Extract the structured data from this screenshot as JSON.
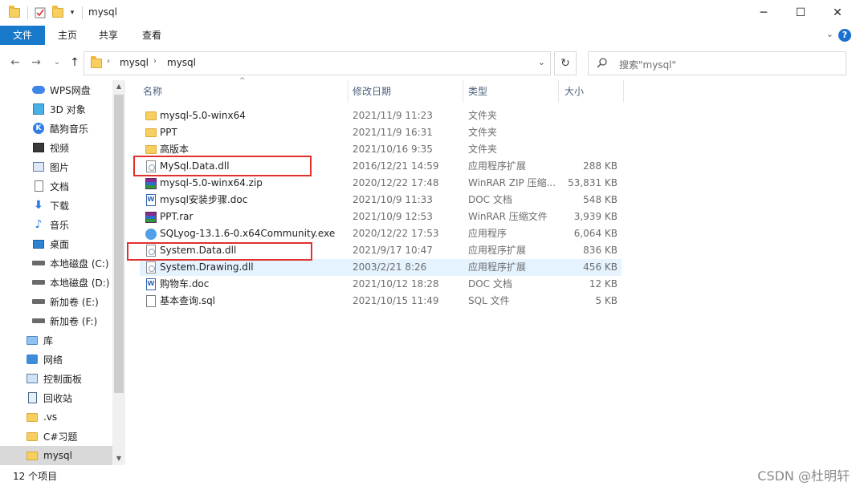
{
  "title_bar": {
    "title": "mysql",
    "minimize": "─",
    "maximize": "☐",
    "close": "✕"
  },
  "ribbon": {
    "tabs": [
      "文件",
      "主页",
      "共享",
      "查看"
    ],
    "help": "?"
  },
  "address": {
    "back": "←",
    "forward": "→",
    "recent": "⌄",
    "up": "↑",
    "crumbs": [
      "mysql",
      "mysql"
    ],
    "crumb_sep": "›",
    "dropdown": "⌄",
    "refresh": "↻",
    "search_placeholder": "搜索\"mysql\""
  },
  "nav": {
    "items": [
      {
        "label": "WPS网盘",
        "icon": "cloud-icon"
      },
      {
        "label": "3D 对象",
        "icon": "cube-icon"
      },
      {
        "label": "酷狗音乐",
        "icon": "kugou-icon"
      },
      {
        "label": "视频",
        "icon": "video-icon"
      },
      {
        "label": "图片",
        "icon": "pictures-icon"
      },
      {
        "label": "文档",
        "icon": "documents-icon"
      },
      {
        "label": "下载",
        "icon": "download-icon"
      },
      {
        "label": "音乐",
        "icon": "music-icon"
      },
      {
        "label": "桌面",
        "icon": "desktop-icon"
      },
      {
        "label": "本地磁盘 (C:)",
        "icon": "drive-icon"
      },
      {
        "label": "本地磁盘 (D:)",
        "icon": "drive-icon"
      },
      {
        "label": "新加卷 (E:)",
        "icon": "drive-icon"
      },
      {
        "label": "新加卷 (F:)",
        "icon": "drive-icon"
      },
      {
        "label": "库",
        "icon": "library-icon"
      },
      {
        "label": "网络",
        "icon": "network-icon"
      },
      {
        "label": "控制面板",
        "icon": "control-panel-icon"
      },
      {
        "label": "回收站",
        "icon": "recycle-bin-icon"
      },
      {
        "label": ".vs",
        "icon": "folder-icon"
      },
      {
        "label": "C#习题",
        "icon": "folder-icon"
      },
      {
        "label": "mysql",
        "icon": "folder-icon",
        "selected": true
      }
    ]
  },
  "columns": {
    "name": "名称",
    "date": "修改日期",
    "type": "类型",
    "size": "大小",
    "sort_indicator": "^"
  },
  "files": [
    {
      "name": "mysql-5.0-winx64",
      "date": "2021/11/9 11:23",
      "type": "文件夹",
      "size": "",
      "icon": "folder"
    },
    {
      "name": "PPT",
      "date": "2021/11/9 16:31",
      "type": "文件夹",
      "size": "",
      "icon": "folder"
    },
    {
      "name": "高版本",
      "date": "2021/10/16 9:35",
      "type": "文件夹",
      "size": "",
      "icon": "folder"
    },
    {
      "name": "MySql.Data.dll",
      "date": "2016/12/21 14:59",
      "type": "应用程序扩展",
      "size": "288 KB",
      "icon": "dll",
      "highlighted": true
    },
    {
      "name": "mysql-5.0-winx64.zip",
      "date": "2020/12/22 17:48",
      "type": "WinRAR ZIP 压缩...",
      "size": "53,831 KB",
      "icon": "rar"
    },
    {
      "name": "mysql安装步骤.doc",
      "date": "2021/10/9 11:33",
      "type": "DOC 文档",
      "size": "548 KB",
      "icon": "doc"
    },
    {
      "name": "PPT.rar",
      "date": "2021/10/9 12:53",
      "type": "WinRAR 压缩文件",
      "size": "3,939 KB",
      "icon": "rar"
    },
    {
      "name": "SQLyog-13.1.6-0.x64Community.exe",
      "date": "2020/12/22 17:53",
      "type": "应用程序",
      "size": "6,064 KB",
      "icon": "exe"
    },
    {
      "name": "System.Data.dll",
      "date": "2021/9/17 10:47",
      "type": "应用程序扩展",
      "size": "836 KB",
      "icon": "dll",
      "highlighted": true
    },
    {
      "name": "System.Drawing.dll",
      "date": "2003/2/21 8:26",
      "type": "应用程序扩展",
      "size": "456 KB",
      "icon": "dll",
      "hover": true
    },
    {
      "name": "购物车.doc",
      "date": "2021/10/12 18:28",
      "type": "DOC 文档",
      "size": "12 KB",
      "icon": "doc"
    },
    {
      "name": "基本查询.sql",
      "date": "2021/10/15 11:49",
      "type": "SQL 文件",
      "size": "5 KB",
      "icon": "txt"
    }
  ],
  "status": {
    "item_count": "12 个项目",
    "watermark": "CSDN @杜明轩"
  },
  "colors": {
    "accent": "#1979ca",
    "highlight_box": "#e0312f",
    "hover_row": "#e5f3ff"
  }
}
